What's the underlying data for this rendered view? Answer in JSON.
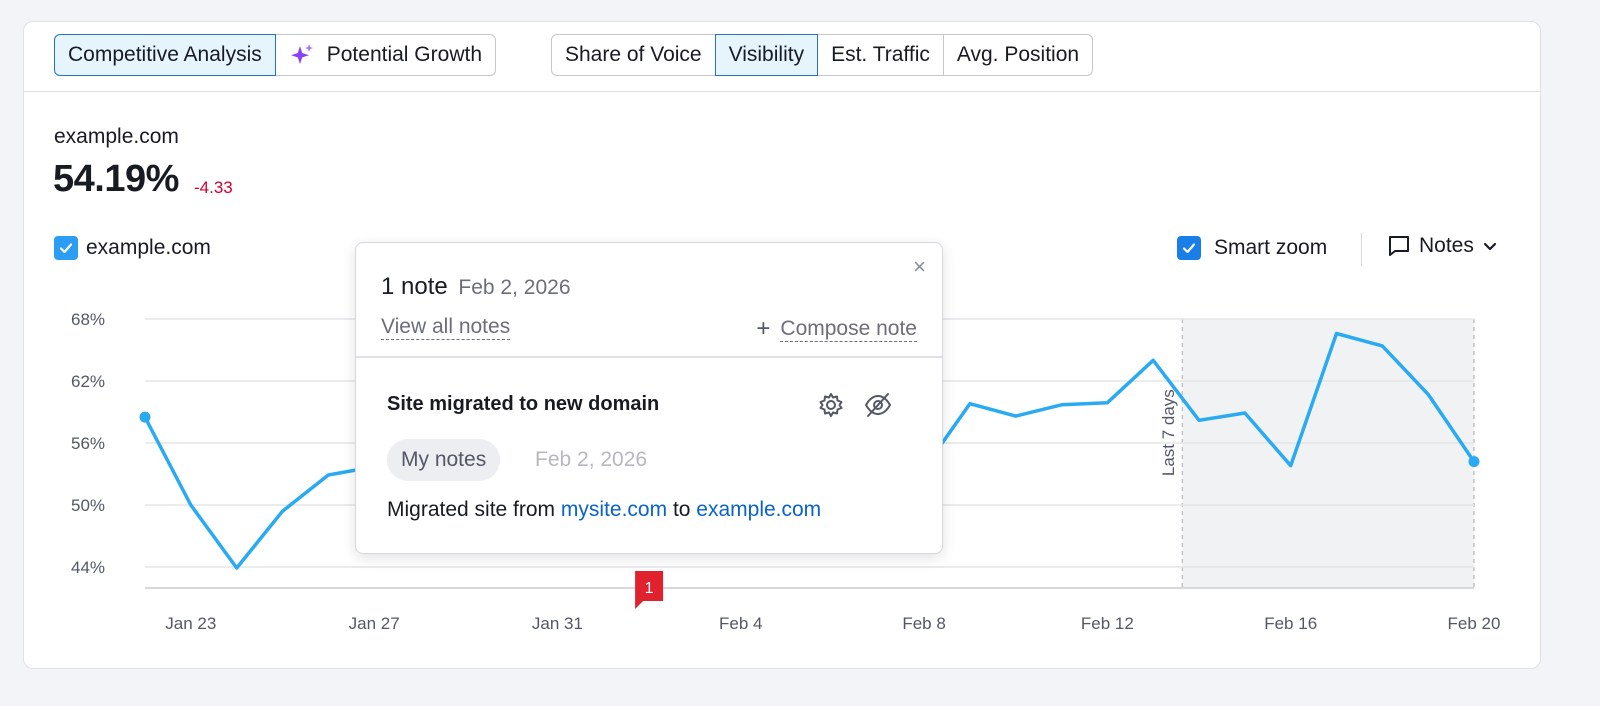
{
  "tabs_primary": [
    {
      "label": "Competitive Analysis",
      "active": true
    },
    {
      "label": "Potential Growth",
      "active": false,
      "icon": "sparkle-icon"
    }
  ],
  "tabs_metric": [
    {
      "label": "Share of Voice",
      "active": false
    },
    {
      "label": "Visibility",
      "active": true
    },
    {
      "label": "Est. Traffic",
      "active": false
    },
    {
      "label": "Avg. Position",
      "active": false
    }
  ],
  "summary": {
    "domain": "example.com",
    "value": "54.19%",
    "delta": "-4.33"
  },
  "legend": {
    "label": "example.com",
    "checked": true
  },
  "controls": {
    "smart_zoom_label": "Smart zoom",
    "smart_zoom_checked": true,
    "notes_label": "Notes"
  },
  "colors": {
    "series": "#2aaaf2",
    "accent": "#2572c9",
    "negative": "#d1002f",
    "note_marker": "#e0222f"
  },
  "chart_data": {
    "type": "line",
    "y_ticks": [
      "68%",
      "62%",
      "56%",
      "50%",
      "44%"
    ],
    "ylim": [
      44,
      68
    ],
    "x_tick_labels": [
      "Jan 23",
      "Jan 27",
      "Jan 31",
      "Feb 4",
      "Feb 8",
      "Feb 12",
      "Feb 16",
      "Feb 20"
    ],
    "x": [
      "Jan 22",
      "Jan 23",
      "Jan 24",
      "Jan 25",
      "Jan 26",
      "Jan 27",
      "Feb 8",
      "Feb 9",
      "Feb 10",
      "Feb 11",
      "Feb 12",
      "Feb 13",
      "Feb 14",
      "Feb 15",
      "Feb 16",
      "Feb 17",
      "Feb 18",
      "Feb 19",
      "Feb 20"
    ],
    "series": [
      {
        "name": "example.com",
        "values": [
          58.5,
          50.0,
          43.9,
          49.4,
          52.9,
          53.7,
          53.5,
          59.8,
          58.6,
          59.7,
          59.9,
          64.0,
          58.2,
          58.9,
          53.8,
          66.6,
          65.4,
          60.7,
          54.2
        ]
      }
    ],
    "shaded_region_label": "Last 7 days",
    "note_marker_count": "1",
    "grid": true
  },
  "popover": {
    "title": "1 note",
    "date": "Feb 2, 2026",
    "view_all": "View all notes",
    "compose": "Compose note",
    "close": "×",
    "note": {
      "title": "Site migrated to new domain",
      "tag": "My notes",
      "date": "Feb 2, 2026",
      "body_prefix": "Migrated site from",
      "link_from": "mysite.com",
      "body_mid": "to",
      "link_to": "example.com"
    }
  }
}
